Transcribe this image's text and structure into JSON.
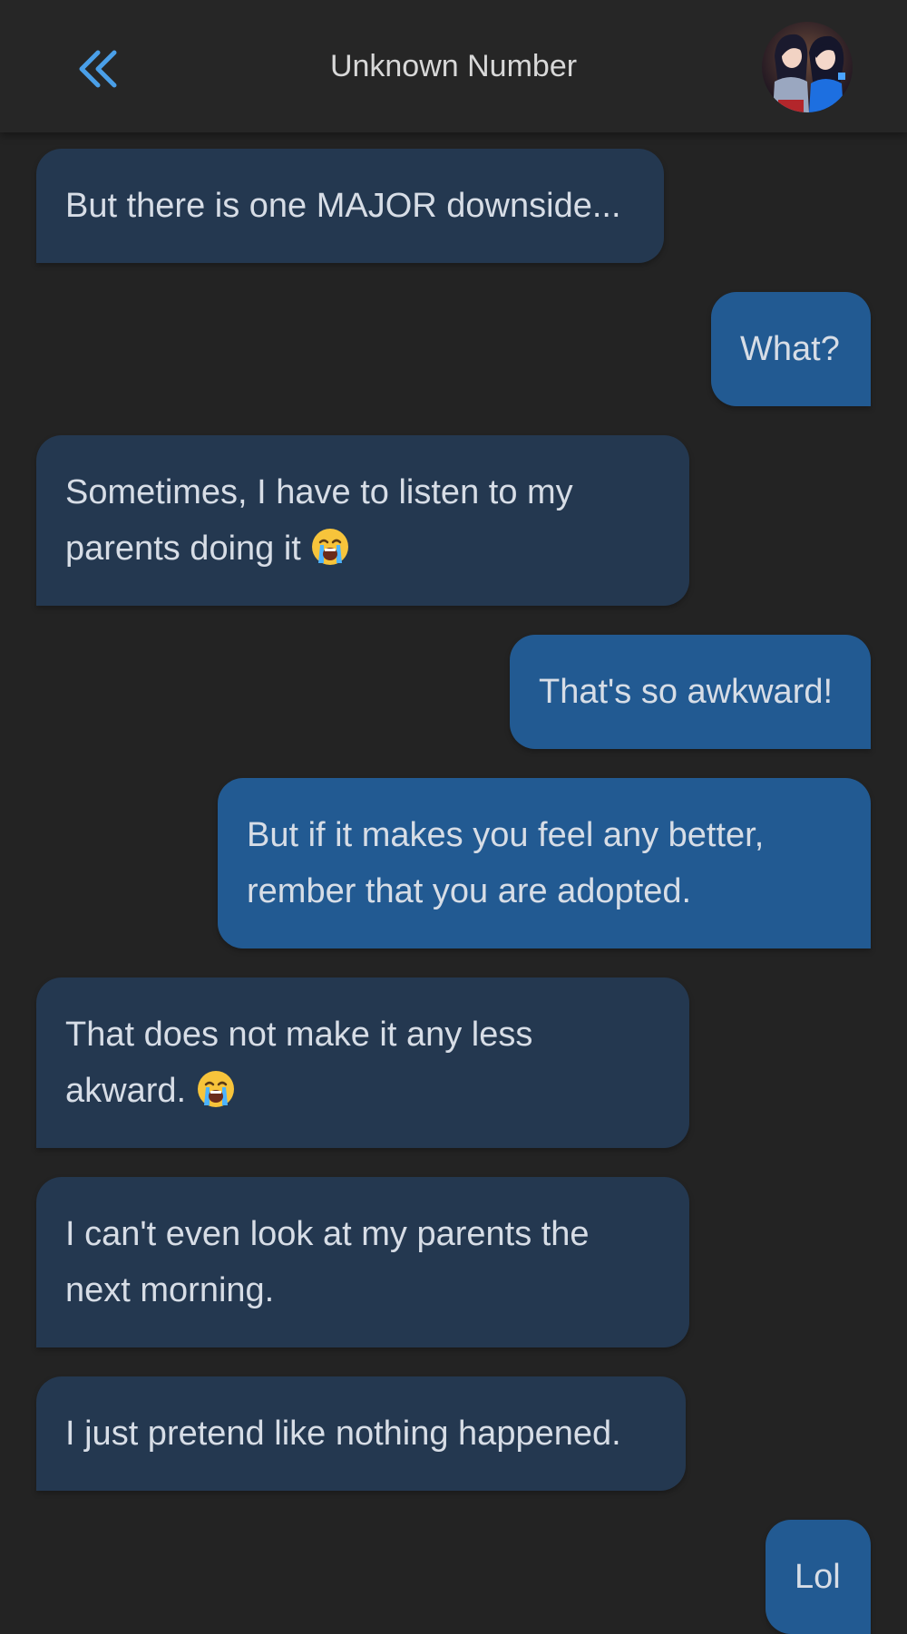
{
  "header": {
    "back_icon": "double-chevron-left-icon",
    "title": "Unknown Number",
    "avatar_icon": "contact-avatar"
  },
  "colors": {
    "background": "#232323",
    "header": "#262626",
    "incoming_bubble": "#243850",
    "outgoing_bubble": "#225a92",
    "accent": "#4a9fe8"
  },
  "messages": [
    {
      "side": "incoming",
      "text": "But there is one MAJOR downside..."
    },
    {
      "side": "outgoing",
      "text": "What?"
    },
    {
      "side": "incoming",
      "text": "Sometimes, I have to listen to my parents doing it",
      "emoji": "crying-face"
    },
    {
      "side": "outgoing",
      "text": "That's so awkward!"
    },
    {
      "side": "outgoing",
      "text": "But if it makes you feel any better, rember that you are adopted."
    },
    {
      "side": "incoming",
      "text": "That does not make it any less akward.",
      "emoji": "crying-face"
    },
    {
      "side": "incoming",
      "text": "I can't even look at my parents the next morning."
    },
    {
      "side": "incoming",
      "text": "I just pretend like nothing happened."
    },
    {
      "side": "outgoing",
      "text": "Lol"
    }
  ]
}
